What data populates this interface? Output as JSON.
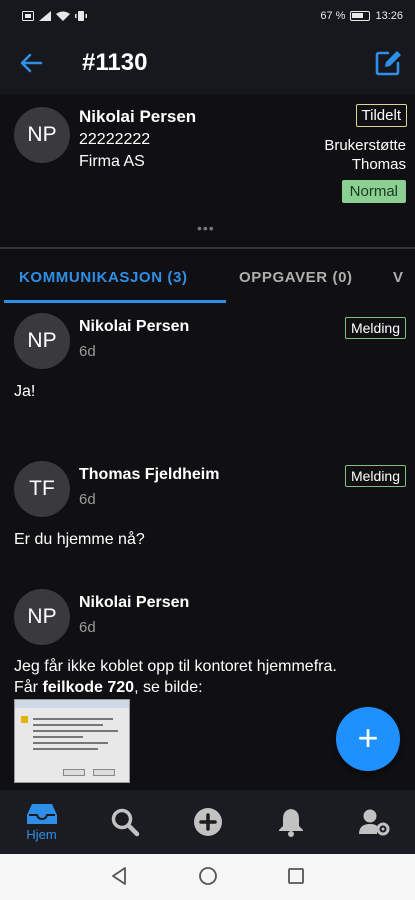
{
  "status_bar": {
    "battery_percent": "67 %",
    "time": "13:26"
  },
  "app_bar": {
    "title": "#1130"
  },
  "ticket": {
    "avatar_initials": "NP",
    "customer_name": "Nikolai Persen",
    "phone": "22222222",
    "company": "Firma AS",
    "status_badge": "Tildelt",
    "group": "Brukerstøtte",
    "assignee": "Thomas",
    "priority": "Normal",
    "more": "•••"
  },
  "tabs": [
    {
      "label": "KOMMUNIKASJON (3)",
      "active": true
    },
    {
      "label": "OPPGAVER (0)",
      "active": false
    },
    {
      "label": "V",
      "active": false
    }
  ],
  "messages": [
    {
      "initials": "NP",
      "author": "Nikolai Persen",
      "time": "6d",
      "badge": "Melding",
      "text": "Ja!"
    },
    {
      "initials": "TF",
      "author": "Thomas Fjeldheim",
      "time": "6d",
      "badge": "Melding",
      "text": "Er du hjemme nå?"
    },
    {
      "initials": "NP",
      "author": "Nikolai Persen",
      "time": "6d",
      "badge": "",
      "text_line1": "Jeg får ikke koblet opp til kontoret hjemmefra.",
      "text_line2_prefix": "Får ",
      "text_line2_bold": "feilkode 720",
      "text_line2_suffix": ", se bilde:"
    }
  ],
  "fab": {
    "label": "+"
  },
  "bottom_nav": [
    {
      "label": "Hjem",
      "icon": "inbox-icon",
      "active": true
    },
    {
      "label": "",
      "icon": "search-icon",
      "active": false
    },
    {
      "label": "",
      "icon": "add-circle-icon",
      "active": false
    },
    {
      "label": "",
      "icon": "bell-icon",
      "active": false
    },
    {
      "label": "",
      "icon": "user-settings-icon",
      "active": false
    }
  ],
  "colors": {
    "accent": "#2f8fe8",
    "fab": "#1e90ff",
    "priority_bg": "#8ccf93",
    "tildelt_border": "#dcd596",
    "melding_border": "#7fbf83"
  }
}
